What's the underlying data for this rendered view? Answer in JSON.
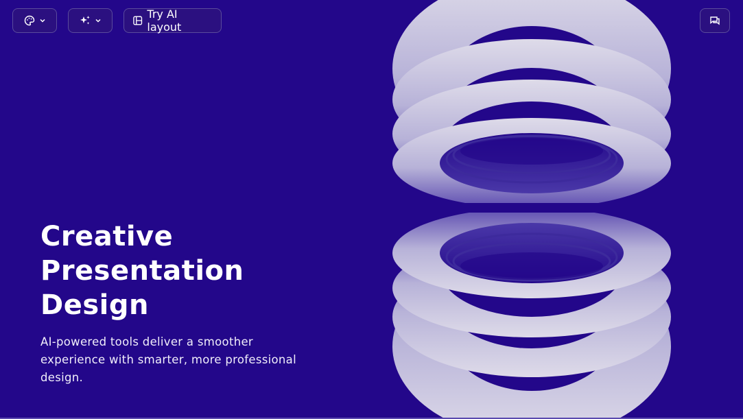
{
  "toolbar": {
    "theme_button_icon": "palette-icon",
    "ai_button_icon": "sparkles-icon",
    "layout_button_icon": "layout-icon",
    "layout_button_label": "Try AI layout",
    "comment_button_icon": "comment-icon"
  },
  "slide": {
    "title_lines": [
      "Creative",
      "Presentation",
      "Design"
    ],
    "subtitle": "AI-powered tools deliver a smoother experience with smarter, more professional design.",
    "background_color": "#23078a",
    "ring_color_light": "#dcd9e8",
    "ring_color_dark": "#6a5bb8"
  }
}
